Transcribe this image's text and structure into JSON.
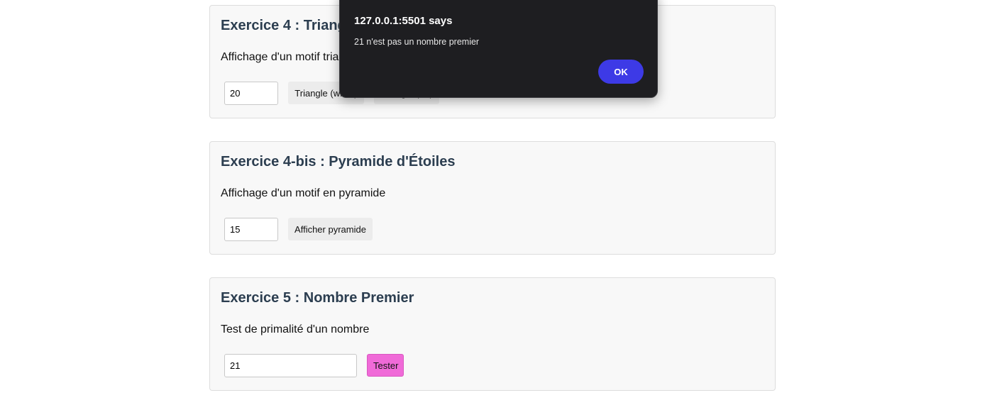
{
  "exercises": [
    {
      "title": "Exercice 4 : Triangle",
      "description": "Affichage d'un motif triangle",
      "input_value": "20",
      "buttons": [
        "Triangle (while)",
        "Triangle (for)"
      ]
    },
    {
      "title": "Exercice 4-bis : Pyramide d'Étoiles",
      "description": "Affichage d'un motif en pyramide",
      "input_value": "15",
      "buttons": [
        "Afficher pyramide"
      ]
    },
    {
      "title": "Exercice 5 : Nombre Premier",
      "description": "Test de primalité d'un nombre",
      "input_value": "21",
      "buttons": [
        "Tester"
      ]
    }
  ],
  "dialog": {
    "title": "127.0.0.1:5501 says",
    "message": "21 n'est pas un nombre premier",
    "ok_label": "OK"
  },
  "colors": {
    "card_background": "#f8f8f8",
    "heading": "#2c3e50",
    "tester_button": "#f06ad8",
    "dialog_background": "#1e1e21",
    "ok_button": "#3d3ae6"
  }
}
